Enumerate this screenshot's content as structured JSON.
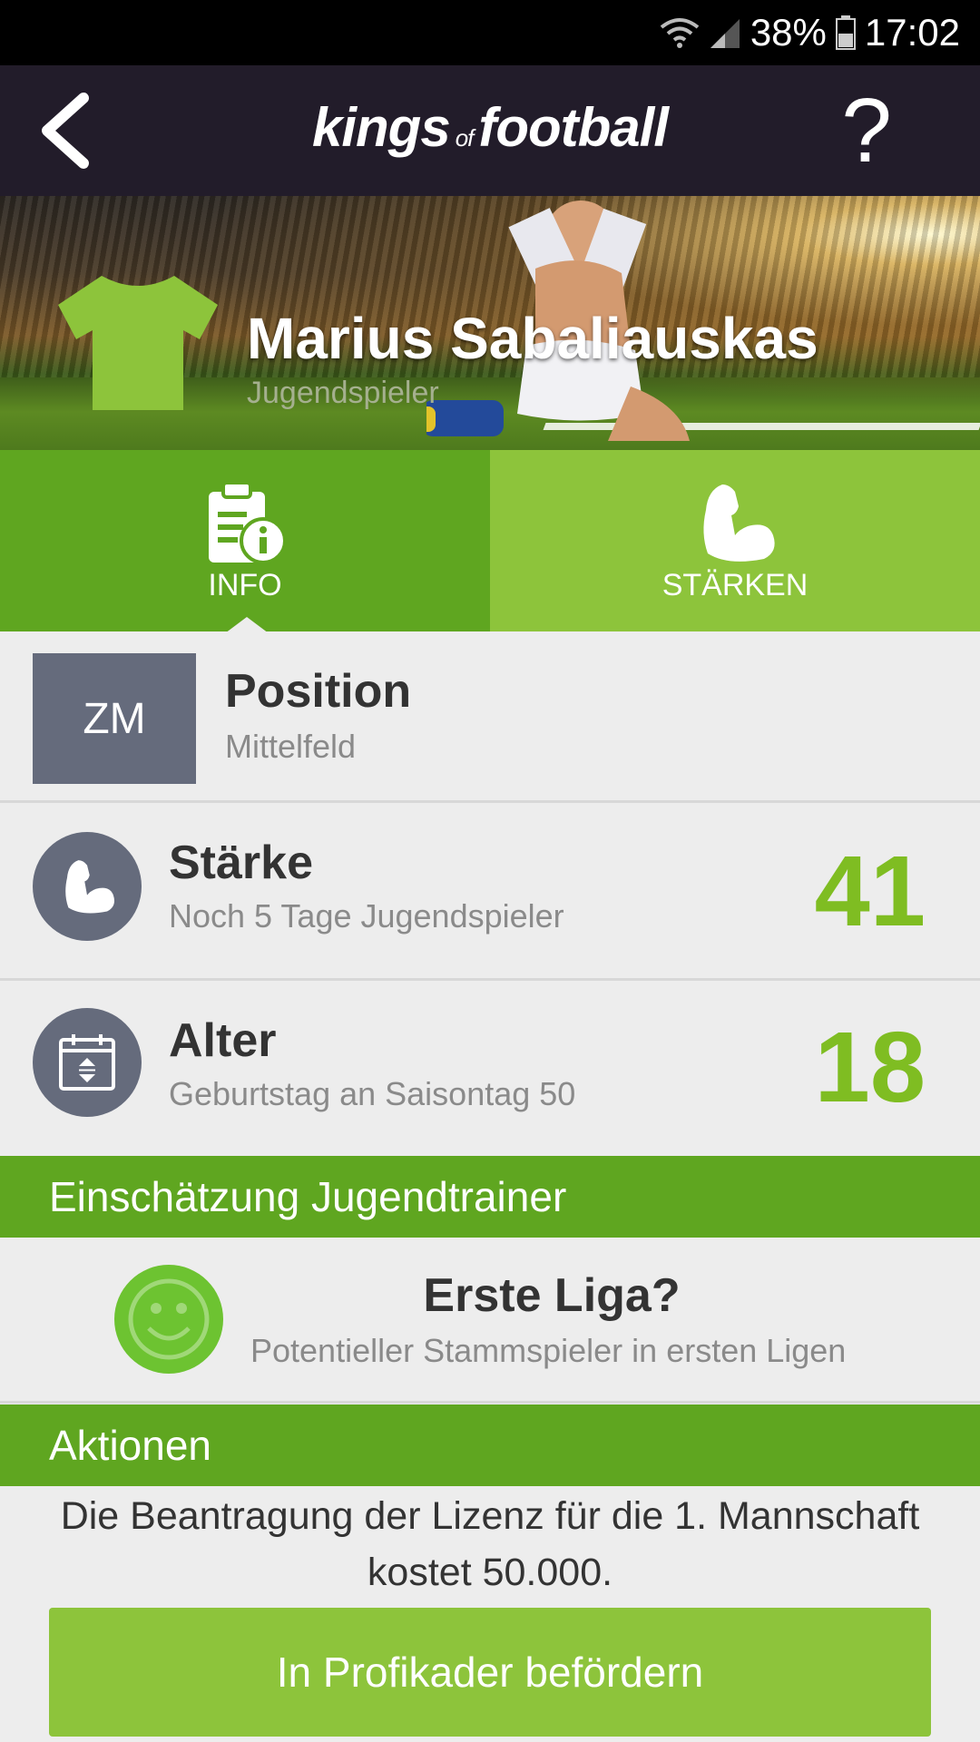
{
  "status_bar": {
    "battery": "38%",
    "time": "17:02"
  },
  "header": {
    "logo_part1": "kings",
    "logo_part2": "of",
    "logo_part3": "football",
    "help_label": "?"
  },
  "player": {
    "name": "Marius Sabaliauskas",
    "type": "Jugendspieler",
    "jersey_color": "#8dc43b"
  },
  "tabs": [
    {
      "label": "INFO",
      "icon": "clipboard-info-icon",
      "active": true
    },
    {
      "label": "STÄRKEN",
      "icon": "flexed-arm-icon",
      "active": false
    }
  ],
  "position": {
    "badge": "ZM",
    "title": "Position",
    "subtitle": "Mittelfeld"
  },
  "strength": {
    "title": "Stärke",
    "subtitle": "Noch 5 Tage Jugendspieler",
    "value": "41",
    "icon": "flexed-arm-icon"
  },
  "age": {
    "title": "Alter",
    "subtitle": "Geburtstag an Saisontag 50",
    "value": "18",
    "icon": "calendar-icon"
  },
  "assessment": {
    "header": "Einschätzung Jugendtrainer",
    "icon": "smiley-icon",
    "title": "Erste Liga?",
    "subtitle": "Potentieller Stammspieler in ersten Ligen"
  },
  "actions": {
    "header": "Aktionen",
    "license_text_line1": "Die Beantragung der Lizenz für die 1. Mannschaft",
    "license_text_line2": "kostet 50.000.",
    "promote_button": "In Profikader befördern"
  },
  "colors": {
    "appbar": "#221c2a",
    "green_dark": "#5fa620",
    "green_light": "#8dc43b",
    "number_green": "#7fbd22",
    "badge_gray": "#656b7c"
  }
}
